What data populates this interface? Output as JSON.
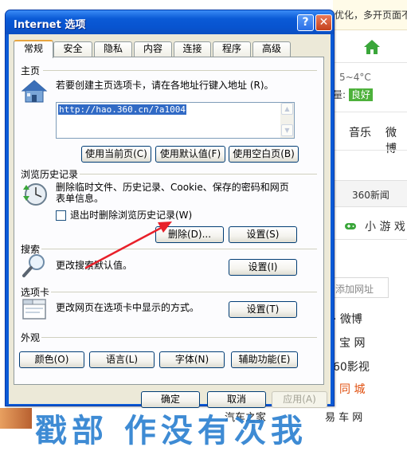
{
  "background": {
    "top_notice": "优化，多开页面不",
    "temperature": "5~4°C",
    "air_label": "量:",
    "air_value": "良好",
    "nav_music": "音乐",
    "nav_weibo": "微博",
    "news_tab": "360新闻",
    "game_link": "小 游 戏",
    "add_site_placeholder": "添加网址",
    "links": [
      "· 微博",
      "宝 网",
      "60影视",
      "同 城",
      "易 车 网",
      "汽车之家"
    ],
    "banner_chars": "戳部 作没有次我"
  },
  "dialog": {
    "title": "Internet 选项",
    "help_glyph": "?",
    "close_glyph": "✕",
    "tabs": [
      "常规",
      "安全",
      "隐私",
      "内容",
      "连接",
      "程序",
      "高级"
    ],
    "homepage": {
      "title": "主页",
      "description": "若要创建主页选项卡，请在各地址行键入地址 (R)。",
      "url": "http://hao.360.cn/?a1004",
      "btn_current": "使用当前页(C)",
      "btn_default": "使用默认值(F)",
      "btn_blank": "使用空白页(B)"
    },
    "history": {
      "title": "浏览历史记录",
      "description_line1": "删除临时文件、历史记录、Cookie、保存的密码和网页",
      "description_line2": "表单信息。",
      "checkbox_label": "退出时删除浏览历史记录(W)",
      "btn_delete": "删除(D)...",
      "btn_settings": "设置(S)"
    },
    "search": {
      "title": "搜索",
      "description": "更改搜索默认值。",
      "btn_settings": "设置(I)"
    },
    "tabs_group": {
      "title": "选项卡",
      "description": "更改网页在选项卡中显示的方式。",
      "btn_settings": "设置(T)"
    },
    "appearance": {
      "title": "外观",
      "btn_colors": "颜色(O)",
      "btn_languages": "语言(L)",
      "btn_fonts": "字体(N)",
      "btn_accessibility": "辅助功能(E)"
    },
    "footer": {
      "ok": "确定",
      "cancel": "取消",
      "apply": "应用(A)"
    }
  },
  "colors": {
    "titlebar": "#0a5ad6",
    "dialog_face": "#ece9d8",
    "arrow": "#e8202a",
    "selection": "#316ac5"
  }
}
